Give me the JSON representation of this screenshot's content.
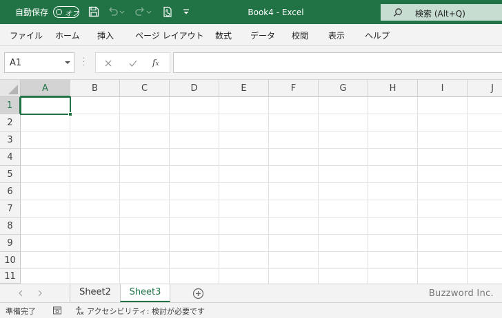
{
  "titlebar": {
    "autosave_label": "自動保存",
    "autosave_state": "オフ",
    "title": "Book4  -  Excel",
    "search_placeholder": "検索 (Alt+Q)",
    "icons": [
      "save-icon",
      "undo-icon",
      "redo-icon",
      "touch-mode-icon",
      "customize-qat-icon",
      "search-icon"
    ]
  },
  "menu": {
    "items": [
      "ファイル",
      "ホーム",
      "挿入",
      "ページ レイアウト",
      "数式",
      "データ",
      "校閲",
      "表示",
      "ヘルプ"
    ]
  },
  "formula_bar": {
    "name_box": "A1",
    "formula": "",
    "icons": [
      "cancel-icon",
      "enter-icon",
      "insert-function-icon"
    ]
  },
  "grid": {
    "columns": [
      "A",
      "B",
      "C",
      "D",
      "E",
      "F",
      "G",
      "H",
      "I",
      "J"
    ],
    "rows": [
      "1",
      "2",
      "3",
      "4",
      "5",
      "6",
      "7",
      "8",
      "9",
      "10",
      "11"
    ],
    "active_cell": "A1"
  },
  "sheets": {
    "tabs": [
      "Sheet2",
      "Sheet3"
    ],
    "active": "Sheet3",
    "watermark": "Buzzword Inc."
  },
  "status": {
    "ready": "準備完了",
    "accessibility": "アクセシビリティ: 検討が必要です"
  },
  "colors": {
    "accent": "#217346",
    "search_bg": "#c8ddd1"
  }
}
